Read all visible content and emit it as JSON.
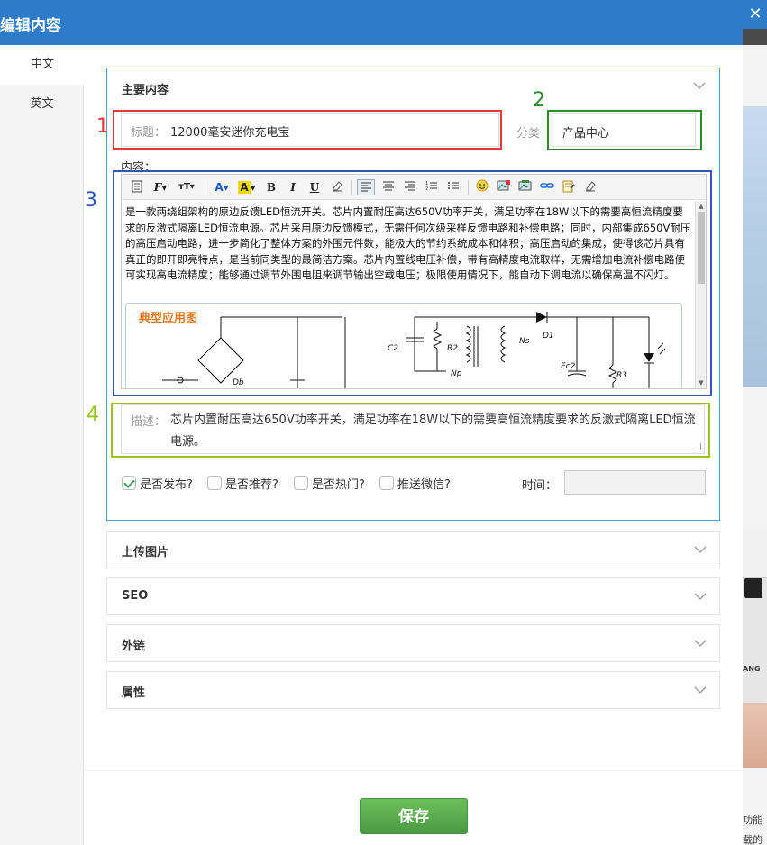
{
  "modal": {
    "title": "编辑内容",
    "close_glyph": "✕",
    "side_tabs": [
      "中文",
      "英文"
    ]
  },
  "main": {
    "panel_title": "主要内容",
    "title_label": "标题：",
    "title_value": "12000毫安迷你充电宝",
    "category_label": "分类",
    "category_value": "产品中心",
    "content_label": "内容：",
    "editor_paragraph": "是一款两绕组架构的原边反馈LED恒流开关。芯片内置耐压高达650V功率开关，满足功率在18W以下的需要高恒流精度要求的反激式隔离LED恒流电源。芯片采用原边反馈模式，无需任何次级采样反馈电路和补偿电路；同时，内部集成650V耐压的高压启动电路，进一步简化了整体方案的外围元件数，能极大的节约系统成本和体积；高压启动的集成，使得该芯片具有真正的即开即亮特点，是当前同类型的最简洁方案。芯片内置线电压补偿，带有高精度电流取样，无需增加电流补偿电路便可实现高电流精度；能够通过调节外围电阻来调节输出空载电压；极限使用情况下，能自动下调电流以确保高温不闪灯。",
    "circuit_title": "典型应用图",
    "circuit_labels": {
      "db": "Db",
      "c2": "C2",
      "r2": "R2",
      "np": "Np",
      "ns": "Ns",
      "d1": "D1",
      "ec2": "Ec2",
      "r3": "R3"
    },
    "desc_label": "描述：",
    "desc_value": "芯片内置耐压高达650V功率开关，满足功率在18W以下的需要高恒流精度要求的反激式隔离LED恒流电源。",
    "checkboxes": [
      {
        "label": "是否发布?",
        "checked": true
      },
      {
        "label": "是否推荐?",
        "checked": false
      },
      {
        "label": "是否热门?",
        "checked": false
      },
      {
        "label": "推送微信?",
        "checked": false
      }
    ],
    "time_label": "时间：",
    "time_value": ""
  },
  "sections": [
    "上传图片",
    "SEO",
    "外链",
    "属性"
  ],
  "save_label": "保存",
  "annotations": [
    {
      "num": "1",
      "color": "#e03a3a"
    },
    {
      "num": "2",
      "color": "#2e8b2e"
    },
    {
      "num": "3",
      "color": "#3355bb"
    },
    {
      "num": "4",
      "color": "#9ac21e"
    }
  ],
  "toolbar_icons": [
    "source-icon",
    "font-family-icon",
    "font-size-icon",
    "font-color-icon",
    "bg-color-icon",
    "bold-icon",
    "italic-icon",
    "underline-icon",
    "eraser-icon",
    "align-left-icon",
    "align-center-icon",
    "align-right-icon",
    "ordered-list-icon",
    "unordered-list-icon",
    "emoji-icon",
    "image-icon",
    "multi-image-icon",
    "link-icon",
    "template-icon",
    "clear-icon"
  ],
  "background_page": {
    "side_label": "ANG",
    "side_text": [
      "功能",
      "载的"
    ]
  }
}
